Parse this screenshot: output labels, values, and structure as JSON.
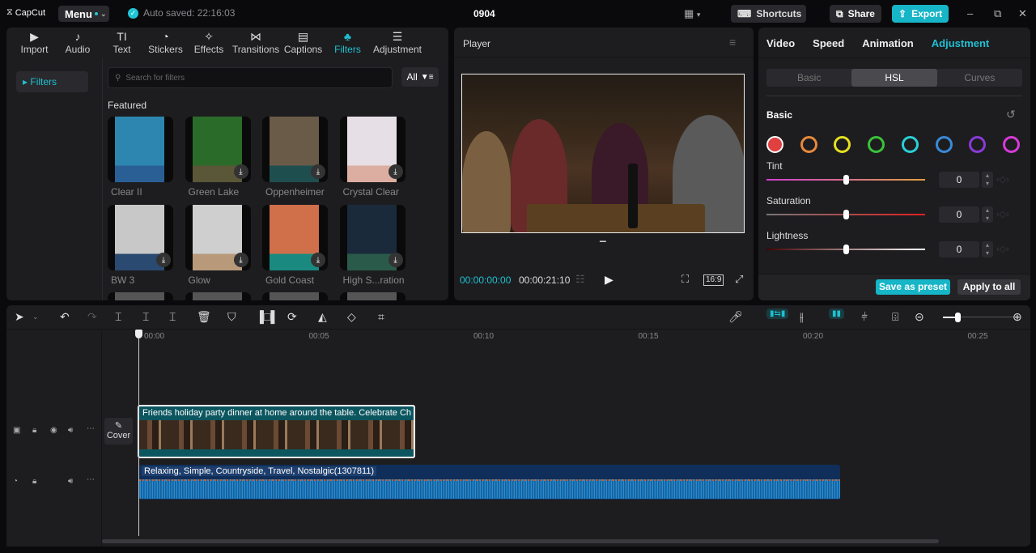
{
  "app": {
    "logo": "CapCut",
    "menu_label": "Menu",
    "autosave": "Auto saved: 22:16:03",
    "project_title": "0904"
  },
  "titlebar": {
    "shortcuts_label": "Shortcuts",
    "share_label": "Share",
    "export_label": "Export",
    "minimize": "–",
    "restore": "⧉",
    "close": "✕"
  },
  "media": {
    "tabs": [
      {
        "label": "Import",
        "icon": "▶"
      },
      {
        "label": "Audio",
        "icon": "♪"
      },
      {
        "label": "Text",
        "icon": "TI"
      },
      {
        "label": "Stickers",
        "icon": "◔"
      },
      {
        "label": "Effects",
        "icon": "✧"
      },
      {
        "label": "Transitions",
        "icon": "⋈"
      },
      {
        "label": "Captions",
        "icon": "▤"
      },
      {
        "label": "Filters",
        "icon": "♣"
      },
      {
        "label": "Adjustment",
        "icon": "☰"
      }
    ],
    "active_tab": "Filters",
    "sidebar_item": "▸ Filters",
    "search_placeholder": "Search for filters",
    "filter_label": "All",
    "section_title": "Featured",
    "filters": [
      {
        "name": "Clear II",
        "bottom": "#2a5f95",
        "top": "#2c86b0",
        "download": false
      },
      {
        "name": "Green Lake",
        "bottom": "#5a5638",
        "top": "#2b6b2a",
        "download": true
      },
      {
        "name": "Oppenheimer",
        "bottom": "#1f4e4e",
        "top": "#6a5a48",
        "download": true
      },
      {
        "name": "Crystal Clear",
        "bottom": "#dcaea2",
        "top": "#e6dfe6",
        "download": true
      },
      {
        "name": "BW 3",
        "bottom": "#2a4a72",
        "top": "#c8c8c8",
        "download": true
      },
      {
        "name": "Glow",
        "bottom": "#b89a7a",
        "top": "#cfcfcf",
        "download": true
      },
      {
        "name": "Gold Coast",
        "bottom": "#1a8a80",
        "top": "#d0704a",
        "download": true
      },
      {
        "name": "High S...ration",
        "bottom": "#2a5a4a",
        "top": "#1a2a3a",
        "download": true
      }
    ]
  },
  "player": {
    "title": "Player",
    "current_time": "00:00:00:00",
    "total_time": "00:00:21:10",
    "ratio": "16:9"
  },
  "properties": {
    "tabs": [
      "Video",
      "Speed",
      "Animation",
      "Adjustment"
    ],
    "active_tab": "Adjustment",
    "subtabs": [
      "Basic",
      "HSL",
      "Curves"
    ],
    "active_subtab": "HSL",
    "section_title": "Basic",
    "hsl_colors": [
      "#e04040",
      "#e8893a",
      "#e6e020",
      "#3ac23a",
      "#2ad0d8",
      "#3a8ad8",
      "#8a3ad8",
      "#d83ad8"
    ],
    "selected_color_index": 0,
    "sliders": [
      {
        "label": "Tint",
        "value": "0",
        "fraction": 0.5
      },
      {
        "label": "Saturation",
        "value": "0",
        "fraction": 0.5
      },
      {
        "label": "Lightness",
        "value": "0",
        "fraction": 0.5
      }
    ],
    "save_preset_label": "Save as preset",
    "apply_all_label": "Apply to all"
  },
  "timeline": {
    "ruler": [
      "00:00",
      "00:05",
      "00:10",
      "00:15",
      "00:20",
      "00:25"
    ],
    "cover_label": "Cover",
    "video_clip_title": "Friends holiday party dinner at home around the table. Celebrate Ch",
    "audio_clip_title": "Relaxing, Simple, Countryside, Travel, Nostalgic(1307811)",
    "zoom_fraction": 0.2
  },
  "colors": {
    "accent": "#1fc0d0",
    "export": "#16b5c7"
  }
}
